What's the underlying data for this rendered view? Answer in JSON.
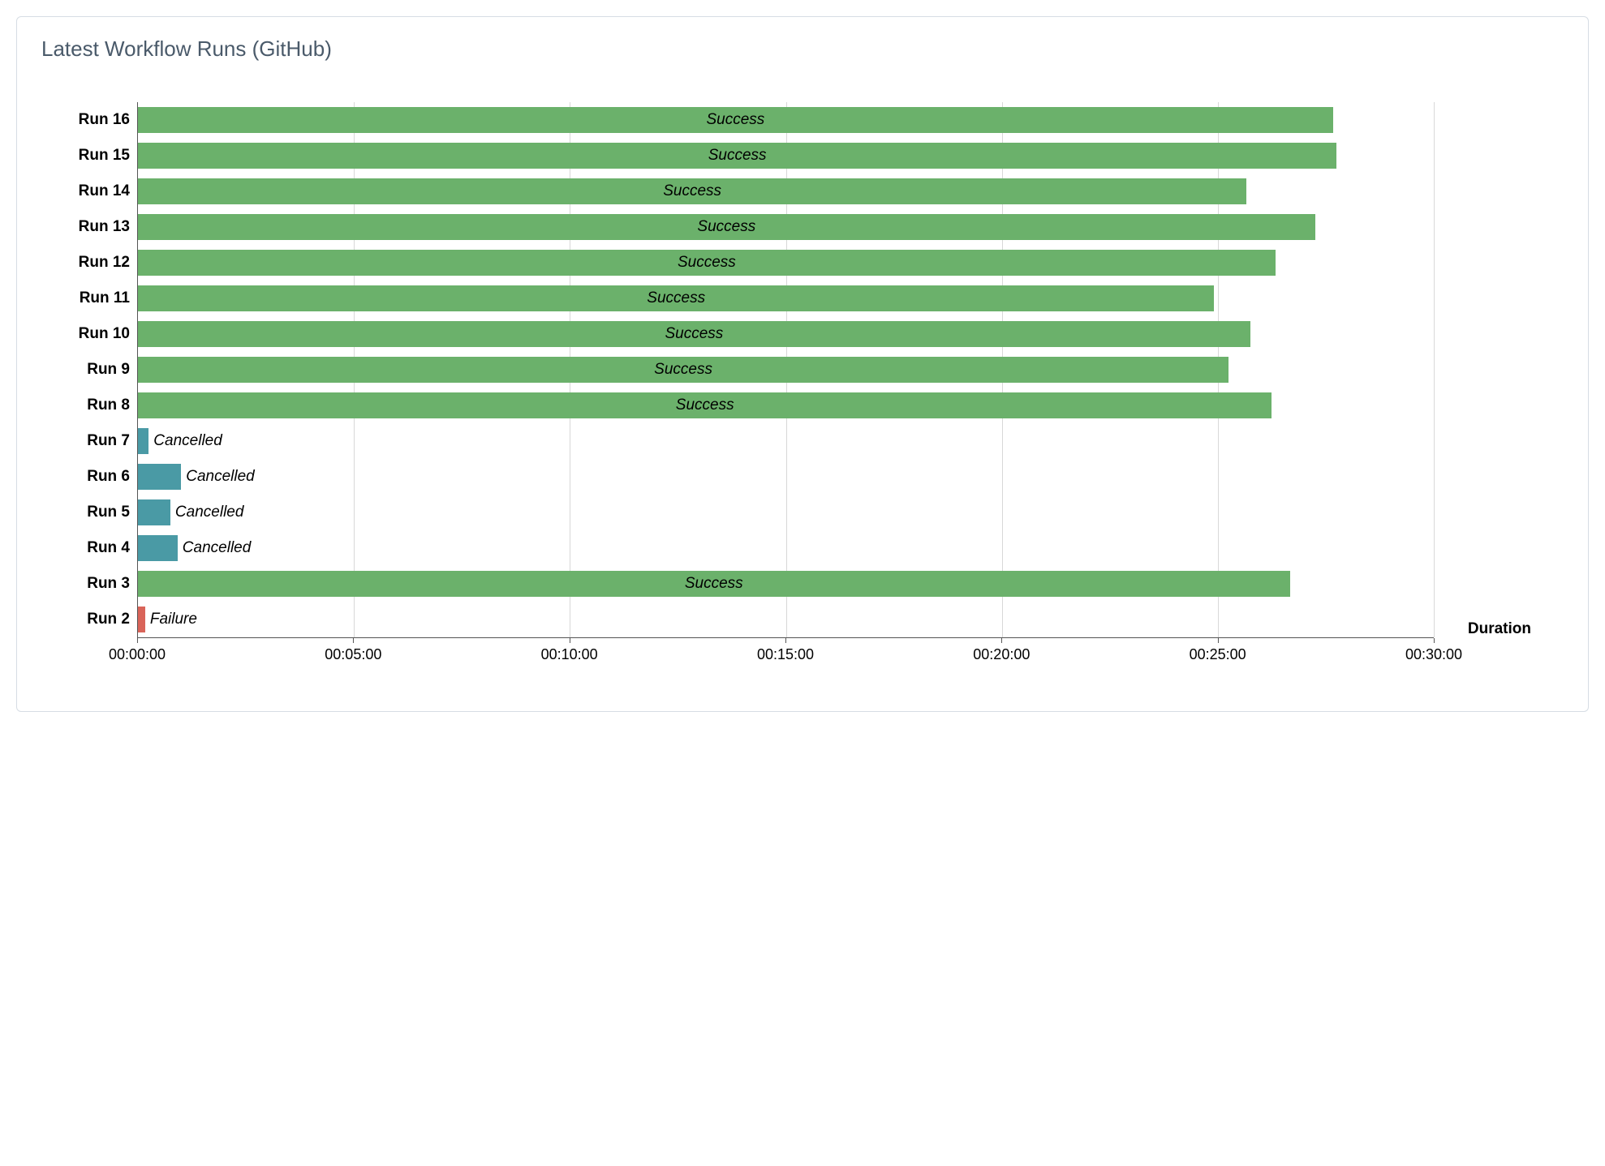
{
  "panel": {
    "title": "Latest Workflow Runs (GitHub)"
  },
  "colors": {
    "Success": "#6bb16b",
    "Cancelled": "#4a9aa5",
    "Failure": "#d96459"
  },
  "chart_data": {
    "type": "bar",
    "orientation": "horizontal",
    "xlabel": "Duration",
    "ylabel": "",
    "x_ticks": [
      "00:00:00",
      "00:05:00",
      "00:10:00",
      "00:15:00",
      "00:20:00",
      "00:25:00",
      "00:30:00"
    ],
    "x_max_seconds": 1800,
    "categories": [
      "Run 16",
      "Run 15",
      "Run 14",
      "Run 13",
      "Run 12",
      "Run 11",
      "Run 10",
      "Run 9",
      "Run 8",
      "Run 7",
      "Run 6",
      "Run 5",
      "Run 4",
      "Run 3",
      "Run 2"
    ],
    "series": [
      {
        "name": "duration_seconds",
        "values": [
          1660,
          1665,
          1540,
          1635,
          1580,
          1495,
          1545,
          1515,
          1575,
          15,
          60,
          45,
          55,
          1600,
          10
        ]
      },
      {
        "name": "status",
        "values": [
          "Success",
          "Success",
          "Success",
          "Success",
          "Success",
          "Success",
          "Success",
          "Success",
          "Success",
          "Cancelled",
          "Cancelled",
          "Cancelled",
          "Cancelled",
          "Success",
          "Failure"
        ]
      }
    ]
  }
}
